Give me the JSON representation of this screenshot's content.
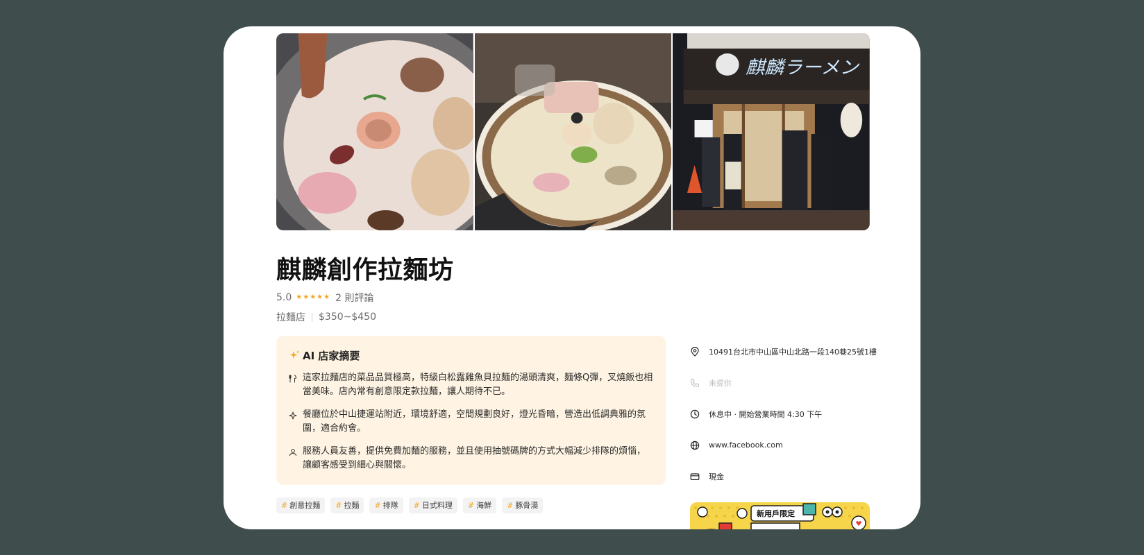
{
  "restaurant": {
    "name": "麒麟創作拉麵坊",
    "rating": "5.0",
    "star_count": 5,
    "reviews": "2 則評論",
    "category": "拉麵店",
    "price_range": "$350~$450"
  },
  "gallery": {
    "photos": [
      "ramen-bowl-photo",
      "white-broth-ramen-photo",
      "storefront-photo"
    ],
    "storefront_sign": "麒麟ラーメン"
  },
  "ai_summary": {
    "title": "AI 店家摘要",
    "items": [
      {
        "icon": "utensils-icon",
        "text": "這家拉麵店的菜品品質極高，特級白松露雞魚貝拉麵的湯頭清爽，麵條Q彈，叉燒飯也相當美味。店內常有創意限定款拉麵，讓人期待不已。"
      },
      {
        "icon": "diamond-sparkle-icon",
        "text": "餐廳位於中山捷運站附近，環境舒適，空間規劃良好，燈光昏暗，營造出低調典雅的氛圍，適合約會。"
      },
      {
        "icon": "person-icon",
        "text": "服務人員友善，提供免費加麵的服務，並且使用抽號碼牌的方式大幅減少排隊的煩惱，讓顧客感受到細心與關懷。"
      }
    ]
  },
  "tags": [
    "創意拉麵",
    "拉麵",
    "排隊",
    "日式料理",
    "海鮮",
    "豚骨湯"
  ],
  "info": {
    "address": "10491台北市中山區中山北路一段140巷25號1樓",
    "phone": "未提供",
    "hours": "休息中 · 開始營業時間 4:30 下午",
    "website": "www.facebook.com",
    "payment": "現金"
  },
  "promo": {
    "badge": "新用戶限定"
  },
  "colors": {
    "background": "#3f4e4c",
    "accent": "#f5a623",
    "summary_bg": "#fff4e3",
    "muted": "#b9bcc2"
  }
}
